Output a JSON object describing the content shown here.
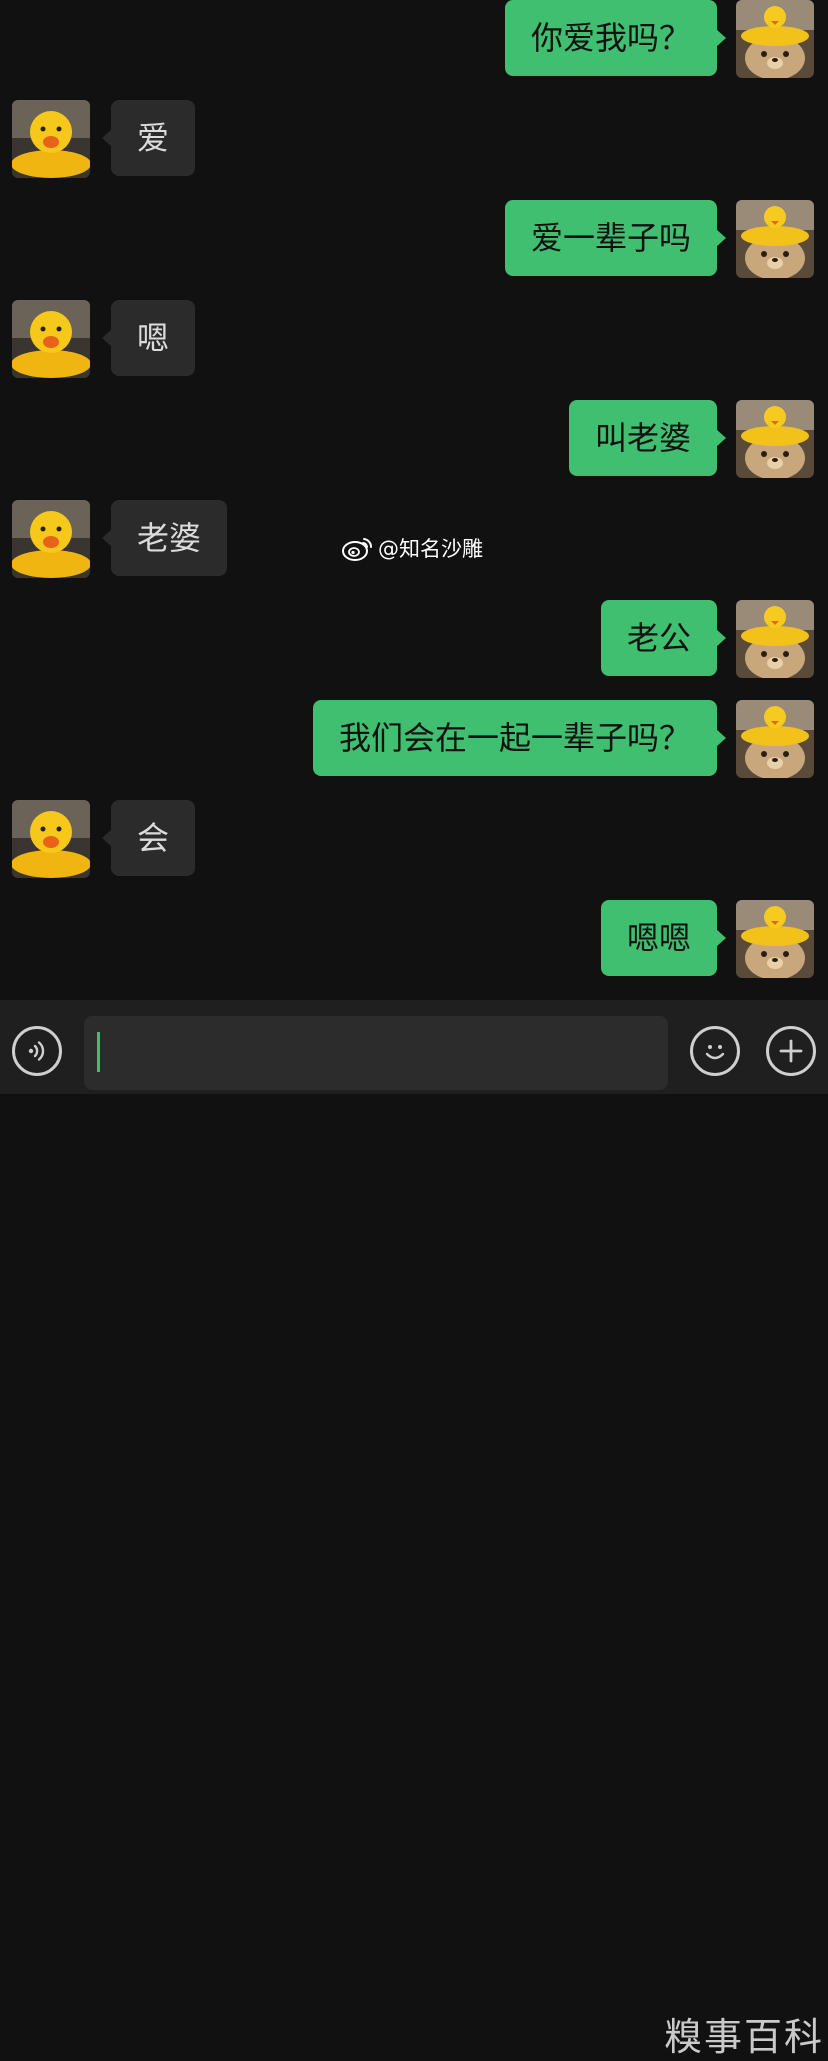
{
  "messages": [
    {
      "side": "out",
      "text": "你爱我吗？"
    },
    {
      "side": "in",
      "text": "爱"
    },
    {
      "side": "out",
      "text": "爱一辈子吗"
    },
    {
      "side": "in",
      "text": "嗯"
    },
    {
      "side": "out",
      "text": "叫老婆"
    },
    {
      "side": "in",
      "text": "老婆"
    },
    {
      "side": "out",
      "text": "老公"
    },
    {
      "side": "out",
      "text": "我们会在一起一辈子吗？"
    },
    {
      "side": "in",
      "text": "会"
    },
    {
      "side": "out",
      "text": "嗯嗯"
    }
  ],
  "watermark": {
    "icon": "weibo-icon",
    "handle": "@知名沙雕"
  },
  "corner_watermark": "糗事百科",
  "input_bar": {
    "voice_icon": "voice-icon",
    "emoji_icon": "emoji-icon",
    "plus_icon": "plus-icon",
    "value": ""
  },
  "colors": {
    "background": "#111111",
    "outgoing_bubble": "#3fbf6f",
    "incoming_bubble": "#2b2b2b",
    "incoming_text": "#dcdcdc",
    "input_bar": "#1f1f1f"
  }
}
